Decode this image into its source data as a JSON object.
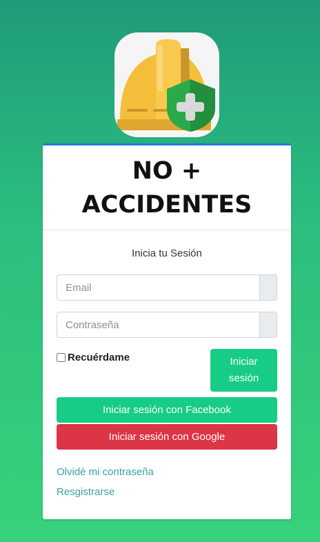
{
  "logo": {
    "icon": "safety-helmet-shield-icon",
    "colors": {
      "helmet": "#f5be3a",
      "shield": "#2aaa49",
      "cross": "#d9d9d9"
    }
  },
  "card": {
    "title_line1": "NO +",
    "title_line2": "ACCIDENTES",
    "subtitle": "Inicia tu Sesión",
    "email_placeholder": "Email",
    "password_placeholder": "Contraseña",
    "remember_label": "Recuérdame",
    "login_button_line1": "Iniciar",
    "login_button_line2": "sesión",
    "facebook_button": "Iniciar sesión con Facebook",
    "google_button": "Iniciar sesión con Google",
    "forgot_link": "Olvidé mi contraseña",
    "register_link": "Resgistrarse"
  },
  "colors": {
    "accent_green": "#17cc86",
    "google_red": "#dc3545",
    "card_top_border": "#1f7be0",
    "link": "#3aa2a2"
  }
}
